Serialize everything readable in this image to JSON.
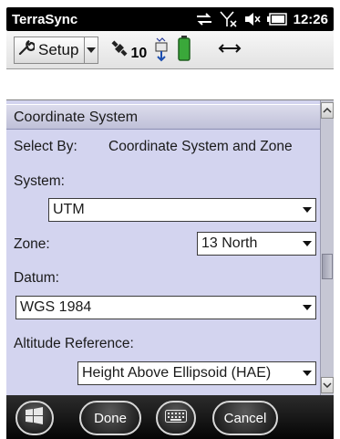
{
  "status_bar": {
    "app_title": "TerraSync",
    "time": "12:26",
    "icons": [
      "sync-arrows-icon",
      "no-signal-icon",
      "speaker-muted-icon",
      "battery-icon"
    ]
  },
  "toolbar": {
    "setup_label": "Setup",
    "satellite_count": "10",
    "icons": [
      "wrench-icon",
      "satellite-icon",
      "gps-receiver-icon",
      "battery-icon",
      "horizontal-arrows-icon"
    ]
  },
  "form": {
    "section_title": "Coordinate System",
    "select_by_label": "Select By:",
    "select_by_value": "Coordinate System and Zone",
    "system_label": "System:",
    "system_value": "UTM",
    "zone_label": "Zone:",
    "zone_value": "13 North",
    "datum_label": "Datum:",
    "datum_value": "WGS 1984",
    "altitude_label": "Altitude Reference:",
    "altitude_value": "Height Above Ellipsoid (HAE)"
  },
  "softkeys": {
    "done_label": "Done",
    "cancel_label": "Cancel"
  },
  "colors": {
    "panel_background": "#d3d4ef",
    "status_bar": "#000000",
    "softkey_bar": "#111111"
  }
}
